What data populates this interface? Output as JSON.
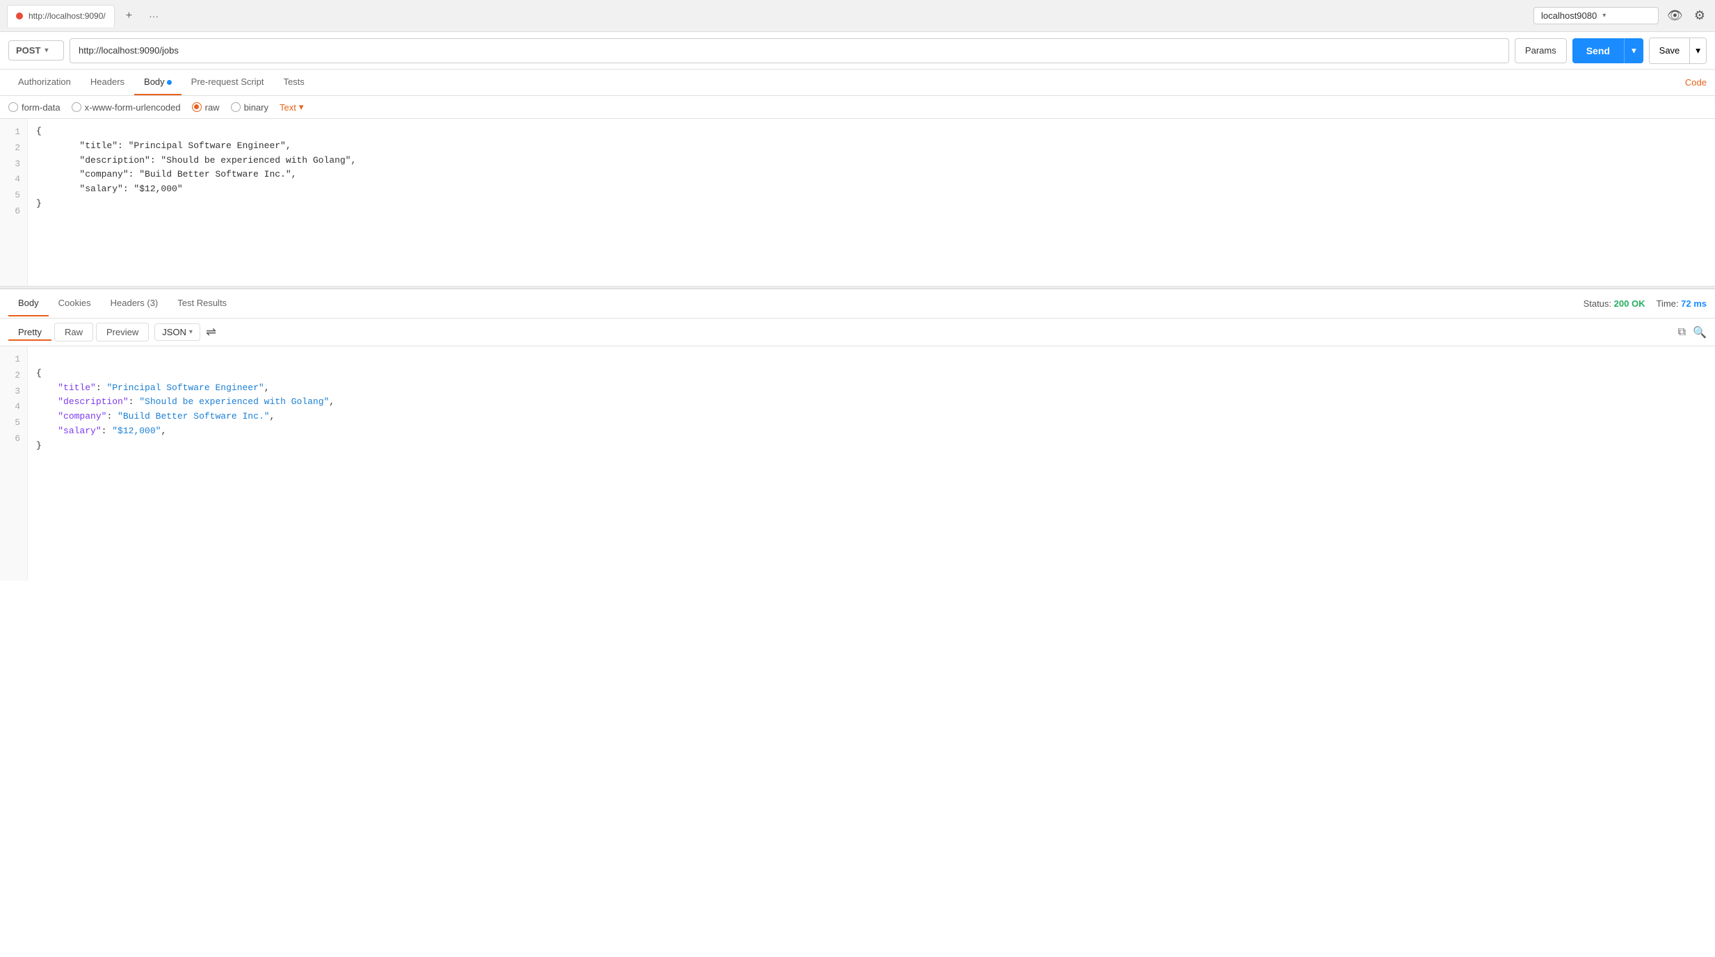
{
  "browser": {
    "tab_url": "http://localhost:9090/",
    "tab_label": "http://localhost:9090/",
    "new_tab_label": "New Tab",
    "new_tab_icon": "+",
    "more_icon": "···",
    "address_bar_value": "localhost9080",
    "eye_icon": "👁",
    "settings_icon": "⚙"
  },
  "toolbar": {
    "method": "POST",
    "url": "http://localhost:9090/jobs",
    "params_label": "Params",
    "send_label": "Send",
    "save_label": "Save"
  },
  "request_tabs": [
    {
      "label": "Authorization",
      "active": false,
      "dot": false
    },
    {
      "label": "Headers",
      "active": false,
      "dot": false
    },
    {
      "label": "Body",
      "active": true,
      "dot": true
    },
    {
      "label": "Pre-request Script",
      "active": false,
      "dot": false
    },
    {
      "label": "Tests",
      "active": false,
      "dot": false
    }
  ],
  "code_link": "Code",
  "body_options": [
    {
      "label": "form-data",
      "checked": false
    },
    {
      "label": "x-www-form-urlencoded",
      "checked": false
    },
    {
      "label": "raw",
      "checked": true
    },
    {
      "label": "binary",
      "checked": false
    }
  ],
  "text_format": "Text",
  "request_body_lines": [
    {
      "num": "1",
      "content": "{"
    },
    {
      "num": "2",
      "content": "        \"title\": \"Principal Software Engineer\","
    },
    {
      "num": "3",
      "content": "        \"description\": \"Should be experienced with Golang\","
    },
    {
      "num": "4",
      "content": "        \"company\": \"Build Better Software Inc.\","
    },
    {
      "num": "5",
      "content": "        \"salary\": \"$12,000\""
    },
    {
      "num": "6",
      "content": "}"
    }
  ],
  "response": {
    "tabs": [
      {
        "label": "Body",
        "active": true
      },
      {
        "label": "Cookies",
        "active": false
      },
      {
        "label": "Headers (3)",
        "active": false
      },
      {
        "label": "Test Results",
        "active": false
      }
    ],
    "status_label": "Status:",
    "status_value": "200 OK",
    "time_label": "Time:",
    "time_value": "72 ms",
    "view_tabs": [
      {
        "label": "Pretty",
        "active": true
      },
      {
        "label": "Raw",
        "active": false
      },
      {
        "label": "Preview",
        "active": false
      }
    ],
    "format": "JSON",
    "response_lines": [
      {
        "num": "1",
        "type": "brace",
        "content": "{"
      },
      {
        "num": "2",
        "key": "\"title\"",
        "value": "\"Principal Software Engineer\"",
        "comma": true
      },
      {
        "num": "3",
        "key": "\"description\"",
        "value": "\"Should be experienced with Golang\"",
        "comma": true
      },
      {
        "num": "4",
        "key": "\"company\"",
        "value": "\"Build Better Software Inc.\"",
        "comma": true
      },
      {
        "num": "5",
        "key": "\"salary\"",
        "value": "\"$12,000\"",
        "comma": true
      },
      {
        "num": "6",
        "type": "brace",
        "content": "}"
      }
    ]
  },
  "icons": {
    "dropdown_arrow": "▾",
    "wrap_icon": "⇌",
    "copy_icon": "⧉",
    "search_icon": "🔍",
    "fold_icon": "▸"
  }
}
